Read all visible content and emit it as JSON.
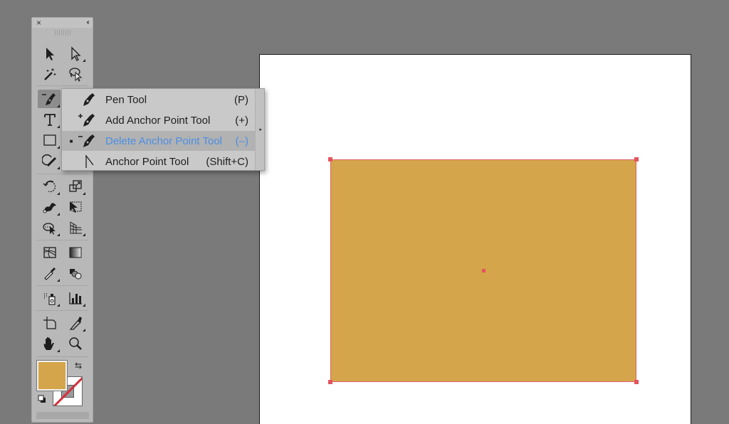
{
  "toolbar": {
    "close_label": "×",
    "collapse_label": "‹‹",
    "tools": [
      {
        "name": "selection-tool",
        "icon": "selection-arrow-icon"
      },
      {
        "name": "direct-selection-tool",
        "icon": "direct-selection-arrow-icon"
      },
      {
        "name": "magic-wand-tool",
        "icon": "magic-wand-icon"
      },
      {
        "name": "lasso-tool",
        "icon": "lasso-icon"
      },
      {
        "name": "delete-anchor-point-tool",
        "icon": "delete-anchor-pen-icon",
        "selected": true
      },
      {
        "name": "type-tool",
        "icon": "type-icon",
        "glyph": "T"
      },
      {
        "name": "rectangle-tool",
        "icon": "rectangle-icon"
      },
      {
        "name": "shaper-tool",
        "icon": "shaper-icon"
      },
      {
        "name": "rotate-tool",
        "icon": "rotate-icon"
      },
      {
        "name": "scale-tool",
        "icon": "scale-icon"
      },
      {
        "name": "width-tool",
        "icon": "width-icon"
      },
      {
        "name": "free-transform-tool",
        "icon": "free-transform-icon"
      },
      {
        "name": "shape-builder-tool",
        "icon": "shape-builder-icon"
      },
      {
        "name": "perspective-grid-tool",
        "icon": "perspective-grid-icon"
      },
      {
        "name": "mesh-tool",
        "icon": "mesh-icon"
      },
      {
        "name": "gradient-tool",
        "icon": "gradient-icon"
      },
      {
        "name": "eyedropper-tool",
        "icon": "eyedropper-icon"
      },
      {
        "name": "blend-tool",
        "icon": "blend-icon"
      },
      {
        "name": "symbol-sprayer-tool",
        "icon": "symbol-sprayer-icon"
      },
      {
        "name": "column-graph-tool",
        "icon": "column-graph-icon"
      },
      {
        "name": "artboard-tool",
        "icon": "artboard-icon"
      },
      {
        "name": "slice-tool",
        "icon": "slice-icon"
      },
      {
        "name": "hand-tool",
        "icon": "hand-icon"
      },
      {
        "name": "zoom-tool",
        "icon": "zoom-icon"
      }
    ],
    "fill_color": "#d4a54a",
    "stroke": "none"
  },
  "flyout_menu": {
    "items": [
      {
        "label": "Pen Tool",
        "shortcut": "(P)",
        "icon": "pen-icon",
        "active": false,
        "check": ""
      },
      {
        "label": "Add Anchor Point Tool",
        "shortcut": "(+)",
        "icon": "add-anchor-pen-icon",
        "active": false,
        "check": ""
      },
      {
        "label": "Delete Anchor Point Tool",
        "shortcut": "(–)",
        "icon": "delete-anchor-pen-icon",
        "active": true,
        "check": "■"
      },
      {
        "label": "Anchor Point Tool",
        "shortcut": "(Shift+C)",
        "icon": "anchor-point-icon",
        "active": false,
        "check": ""
      }
    ],
    "tearoff_arrow": "▸"
  },
  "canvas": {
    "artboard_color": "#ffffff",
    "shape": {
      "type": "rectangle",
      "fill": "#d4a54a",
      "selection_color": "#e3545e",
      "selected": true
    }
  },
  "colors": {
    "workspace": "#7a7a7a",
    "highlight_text": "#4a8ee3"
  }
}
